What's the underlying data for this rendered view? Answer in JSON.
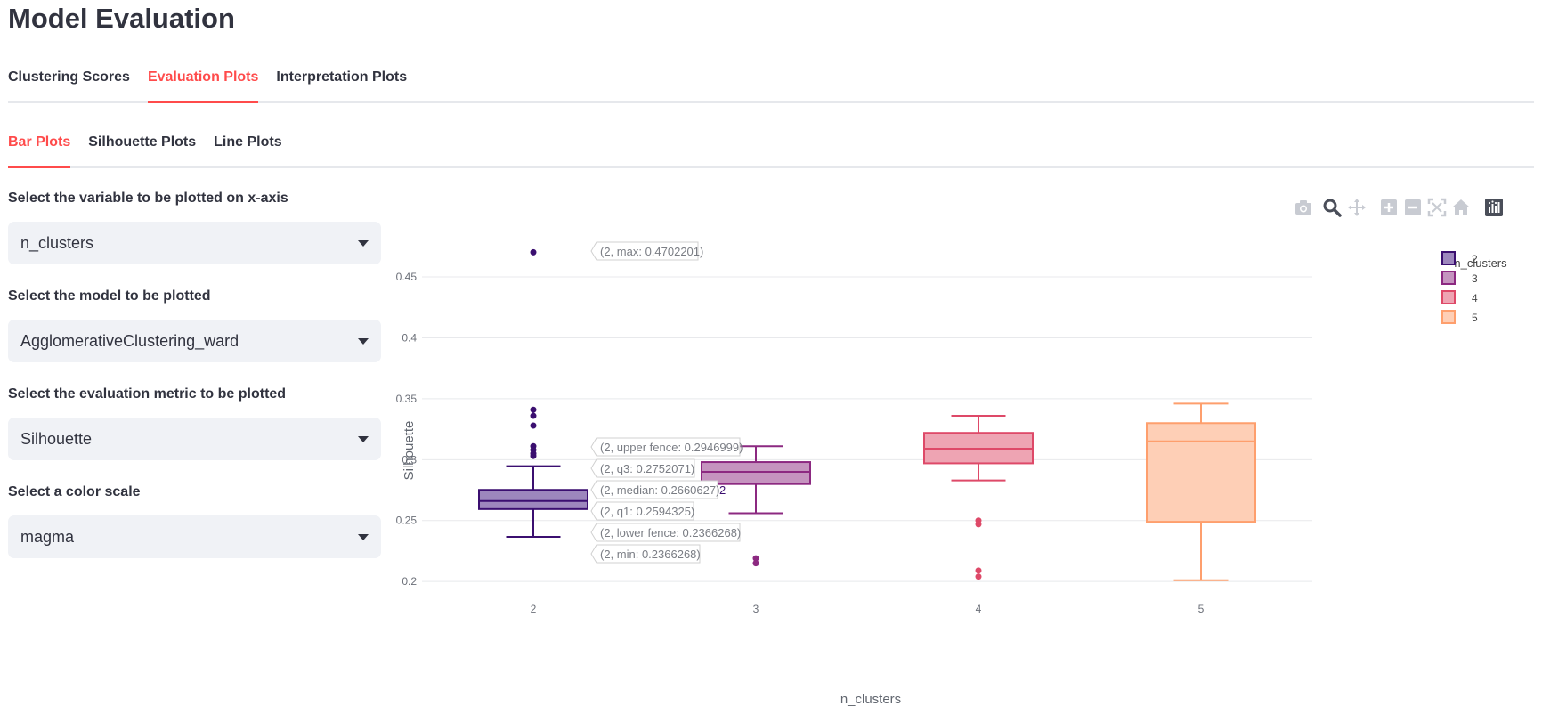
{
  "page": {
    "title": "Model Evaluation"
  },
  "tabs": [
    {
      "label": "Clustering Scores",
      "active": false
    },
    {
      "label": "Evaluation Plots",
      "active": true
    },
    {
      "label": "Interpretation Plots",
      "active": false
    }
  ],
  "subtabs": [
    {
      "label": "Bar Plots",
      "active": true
    },
    {
      "label": "Silhouette Plots",
      "active": false
    },
    {
      "label": "Line Plots",
      "active": false
    }
  ],
  "controls": {
    "x_axis": {
      "label": "Select the variable to be plotted on x-axis",
      "value": "n_clusters"
    },
    "model": {
      "label": "Select the model to be plotted",
      "value": "AgglomerativeClustering_ward"
    },
    "metric": {
      "label": "Select the evaluation metric to be plotted",
      "value": "Silhouette"
    },
    "color_scale": {
      "label": "Select a color scale",
      "value": "magma"
    }
  },
  "modebar": {
    "icons": [
      "camera-icon",
      "zoom-icon",
      "pan-icon",
      "zoom-in-icon",
      "zoom-out-icon",
      "autoscale-icon",
      "reset-axes-icon",
      "plotly-logo-icon"
    ]
  },
  "hover_label": {
    "max": "(2, max: 0.4702201)",
    "upper_fence": "(2, upper fence: 0.2946999)",
    "q3": "(2, q3: 0.2752071)",
    "median": "(2, median: 0.2660627)",
    "q1": "(2, q1: 0.2594325)",
    "lower_fence": "(2, lower fence: 0.2366268)",
    "min": "(2, min: 0.2366268)",
    "trace_name": "2"
  },
  "chart_data": {
    "type": "box",
    "xlabel": "n_clusters",
    "ylabel": "Silhouette",
    "ylim": [
      0.195,
      0.48
    ],
    "yticks": [
      0.2,
      0.25,
      0.3,
      0.35,
      0.4,
      0.45
    ],
    "categories": [
      "2",
      "3",
      "4",
      "5"
    ],
    "legend": {
      "title": "n_clusters",
      "placement": "top-right"
    },
    "grid": true,
    "series": [
      {
        "name": "2",
        "color": "#3b0f70",
        "fill": "#9d87bd",
        "lower_fence": 0.2366268,
        "q1": 0.2594325,
        "median": 0.2660627,
        "q3": 0.2752071,
        "upper_fence": 0.2946999,
        "outliers": [
          0.4702201,
          0.341,
          0.336,
          0.328,
          0.311,
          0.308,
          0.305,
          0.303
        ]
      },
      {
        "name": "3",
        "color": "#8c2981",
        "fill": "#c594bf",
        "lower_fence": 0.256,
        "q1": 0.28,
        "median": 0.29,
        "q3": 0.298,
        "upper_fence": 0.311,
        "outliers": [
          0.219,
          0.215
        ]
      },
      {
        "name": "4",
        "color": "#de4968",
        "fill": "#eea4b3",
        "lower_fence": 0.283,
        "q1": 0.297,
        "median": 0.309,
        "q3": 0.322,
        "upper_fence": 0.336,
        "outliers": [
          0.25,
          0.247,
          0.209,
          0.204
        ]
      },
      {
        "name": "5",
        "color": "#fe9f6d",
        "fill": "#fecfb6",
        "lower_fence": 0.201,
        "q1": 0.249,
        "median": 0.315,
        "q3": 0.33,
        "upper_fence": 0.346,
        "outliers": []
      }
    ]
  }
}
